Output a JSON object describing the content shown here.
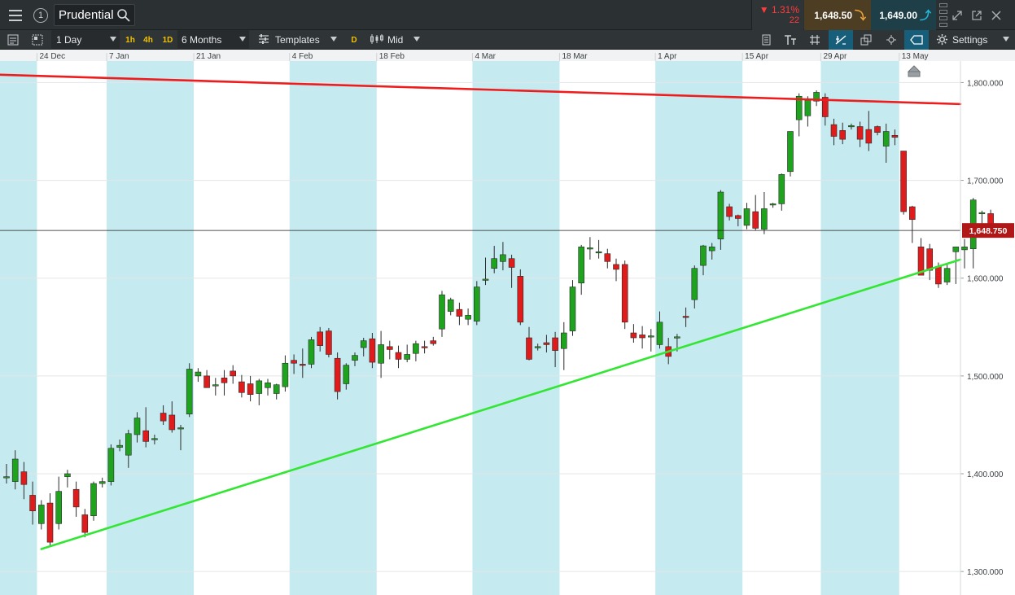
{
  "header": {
    "market": "Prudential",
    "change_pct": "▼ 1.31%",
    "change_pts": "22",
    "sell_price": "1,648.50",
    "buy_price": "1,649.00"
  },
  "toolbar": {
    "interval": "1 Day",
    "quick_intervals": [
      "1h",
      "4h",
      "1D"
    ],
    "range": "6 Months",
    "templates": "Templates",
    "price_type_badge": "D",
    "price_type": "Mid",
    "settings": "Settings"
  },
  "colors": {
    "bull": "#1fa31f",
    "bear": "#e01b1b",
    "band": "#c5eaf0",
    "resistance": "#ee1c1c",
    "support": "#33e633",
    "price_tag": "#b01818"
  },
  "chart_data": {
    "type": "candlestick",
    "current_price_label": "1,648.750",
    "current_price": 1648.75,
    "x_labels": [
      "24 Dec",
      "7 Jan",
      "21 Jan",
      "4 Feb",
      "18 Feb",
      "4 Mar",
      "18 Mar",
      "1 Apr",
      "15 Apr",
      "29 Apr",
      "13 May"
    ],
    "y_ticks": [
      1300,
      1400,
      1500,
      1600,
      1700,
      1800
    ],
    "y_tick_labels": [
      "1,300.000",
      "1,400.000",
      "1,500.000",
      "1,600.000",
      "1,700.000",
      "1,800.000"
    ],
    "ylim": [
      1276,
      1822
    ],
    "n_bars": 117,
    "week_bands": [
      [
        0,
        4
      ],
      [
        12,
        22
      ],
      [
        33,
        43
      ],
      [
        54,
        64
      ],
      [
        75,
        85
      ],
      [
        94,
        103
      ]
    ],
    "ohlc": [
      [
        1397,
        1410,
        1390,
        1397
      ],
      [
        1392,
        1424,
        1384,
        1415
      ],
      [
        1402,
        1412,
        1374,
        1389
      ],
      [
        1378,
        1392,
        1348,
        1362
      ],
      [
        1349,
        1373,
        1343,
        1368
      ],
      [
        1370,
        1380,
        1326,
        1330
      ],
      [
        1349,
        1397,
        1343,
        1382
      ],
      [
        1397,
        1404,
        1386,
        1400
      ],
      [
        1384,
        1392,
        1356,
        1366
      ],
      [
        1358,
        1364,
        1335,
        1340
      ],
      [
        1357,
        1392,
        1352,
        1390
      ],
      [
        1390,
        1396,
        1386,
        1392
      ],
      [
        1392,
        1430,
        1388,
        1426
      ],
      [
        1427,
        1435,
        1423,
        1429
      ],
      [
        1419,
        1445,
        1406,
        1441
      ],
      [
        1440,
        1463,
        1432,
        1457
      ],
      [
        1444,
        1468,
        1427,
        1433
      ],
      [
        1435,
        1440,
        1430,
        1436
      ],
      [
        1462,
        1470,
        1450,
        1454
      ],
      [
        1460,
        1474,
        1442,
        1445
      ],
      [
        1446,
        1450,
        1424,
        1447
      ],
      [
        1461,
        1513,
        1458,
        1507
      ],
      [
        1500,
        1508,
        1494,
        1504
      ],
      [
        1500,
        1506,
        1488,
        1488
      ],
      [
        1490,
        1498,
        1480,
        1491
      ],
      [
        1498,
        1506,
        1480,
        1493
      ],
      [
        1505,
        1511,
        1492,
        1500
      ],
      [
        1494,
        1501,
        1478,
        1483
      ],
      [
        1492,
        1500,
        1474,
        1481
      ],
      [
        1482,
        1497,
        1470,
        1495
      ],
      [
        1488,
        1497,
        1480,
        1493
      ],
      [
        1482,
        1492,
        1476,
        1491
      ],
      [
        1489,
        1521,
        1484,
        1513
      ],
      [
        1516,
        1522,
        1502,
        1513
      ],
      [
        1512,
        1528,
        1498,
        1511
      ],
      [
        1512,
        1540,
        1508,
        1537
      ],
      [
        1545,
        1550,
        1525,
        1531
      ],
      [
        1546,
        1549,
        1519,
        1522
      ],
      [
        1518,
        1524,
        1476,
        1484
      ],
      [
        1492,
        1513,
        1486,
        1511
      ],
      [
        1516,
        1524,
        1510,
        1521
      ],
      [
        1529,
        1539,
        1520,
        1536
      ],
      [
        1538,
        1544,
        1508,
        1514
      ],
      [
        1513,
        1546,
        1498,
        1532
      ],
      [
        1530,
        1536,
        1517,
        1527
      ],
      [
        1524,
        1531,
        1508,
        1517
      ],
      [
        1517,
        1532,
        1514,
        1522
      ],
      [
        1523,
        1536,
        1515,
        1533
      ],
      [
        1530,
        1536,
        1523,
        1529
      ],
      [
        1536,
        1540,
        1531,
        1533
      ],
      [
        1548,
        1587,
        1540,
        1583
      ],
      [
        1566,
        1580,
        1562,
        1578
      ],
      [
        1568,
        1575,
        1552,
        1561
      ],
      [
        1558,
        1569,
        1552,
        1562
      ],
      [
        1556,
        1597,
        1552,
        1591
      ],
      [
        1599,
        1621,
        1593,
        1599
      ],
      [
        1610,
        1633,
        1605,
        1620
      ],
      [
        1617,
        1637,
        1608,
        1624
      ],
      [
        1620,
        1624,
        1590,
        1611
      ],
      [
        1602,
        1609,
        1552,
        1555
      ],
      [
        1539,
        1550,
        1516,
        1517
      ],
      [
        1530,
        1533,
        1526,
        1530
      ],
      [
        1534,
        1542,
        1524,
        1532
      ],
      [
        1539,
        1545,
        1509,
        1526
      ],
      [
        1528,
        1555,
        1506,
        1544
      ],
      [
        1546,
        1598,
        1541,
        1591
      ],
      [
        1595,
        1634,
        1583,
        1632
      ],
      [
        1630,
        1642,
        1619,
        1631
      ],
      [
        1627,
        1639,
        1620,
        1627
      ],
      [
        1625,
        1630,
        1610,
        1617
      ],
      [
        1614,
        1620,
        1597,
        1609
      ],
      [
        1614,
        1618,
        1548,
        1555
      ],
      [
        1544,
        1553,
        1534,
        1539
      ],
      [
        1542,
        1551,
        1528,
        1539
      ],
      [
        1540,
        1548,
        1525,
        1541
      ],
      [
        1532,
        1566,
        1528,
        1555
      ],
      [
        1530,
        1539,
        1512,
        1520
      ],
      [
        1539,
        1543,
        1525,
        1540
      ],
      [
        1561,
        1570,
        1550,
        1560
      ],
      [
        1578,
        1613,
        1569,
        1610
      ],
      [
        1613,
        1634,
        1603,
        1633
      ],
      [
        1628,
        1636,
        1619,
        1632
      ],
      [
        1640,
        1690,
        1629,
        1688
      ],
      [
        1673,
        1676,
        1659,
        1663
      ],
      [
        1664,
        1665,
        1653,
        1661
      ],
      [
        1654,
        1677,
        1650,
        1671
      ],
      [
        1668,
        1685,
        1649,
        1651
      ],
      [
        1650,
        1688,
        1645,
        1671
      ],
      [
        1675,
        1677,
        1672,
        1676
      ],
      [
        1676,
        1707,
        1669,
        1706
      ],
      [
        1709,
        1750,
        1704,
        1750
      ],
      [
        1762,
        1789,
        1745,
        1786
      ],
      [
        1766,
        1786,
        1755,
        1782
      ],
      [
        1781,
        1792,
        1776,
        1790
      ],
      [
        1785,
        1789,
        1756,
        1765
      ],
      [
        1757,
        1763,
        1736,
        1745
      ],
      [
        1751,
        1759,
        1737,
        1742
      ],
      [
        1755,
        1758,
        1752,
        1756
      ],
      [
        1755,
        1760,
        1734,
        1742
      ],
      [
        1752,
        1771,
        1730,
        1738
      ],
      [
        1755,
        1756,
        1746,
        1749
      ],
      [
        1735,
        1758,
        1718,
        1750
      ],
      [
        1746,
        1752,
        1736,
        1744
      ],
      [
        1730,
        1730,
        1665,
        1668
      ],
      [
        1673,
        1674,
        1636,
        1660
      ],
      [
        1632,
        1641,
        1605,
        1603
      ],
      [
        1630,
        1635,
        1598,
        1608
      ],
      [
        1612,
        1616,
        1590,
        1594
      ],
      [
        1596,
        1614,
        1593,
        1610
      ],
      [
        1627,
        1631,
        1594,
        1632
      ],
      [
        1629,
        1640,
        1610,
        1632
      ],
      [
        1630,
        1682,
        1610,
        1680
      ],
      [
        1666,
        1669,
        1650,
        1667
      ],
      [
        1666,
        1670,
        1648,
        1651
      ]
    ],
    "trendlines": [
      {
        "name": "resistance",
        "from": [
          -1,
          1808
        ],
        "to": [
          116,
          1778
        ]
      },
      {
        "name": "support",
        "from": [
          4,
          1323
        ],
        "to": [
          116,
          1619
        ]
      }
    ]
  }
}
